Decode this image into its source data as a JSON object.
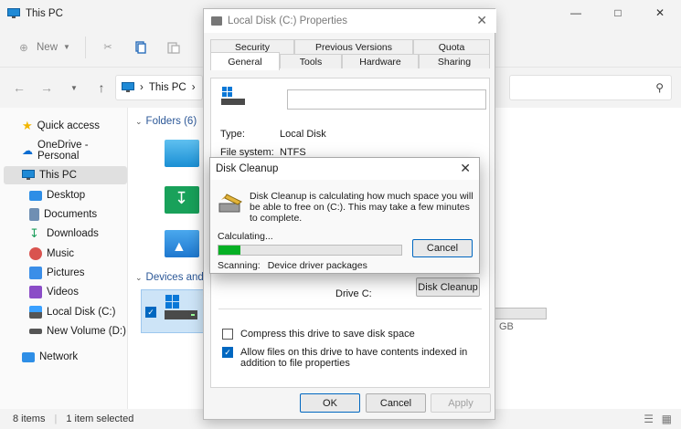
{
  "explorer": {
    "title": "This PC",
    "cmd": {
      "new_label": "New"
    },
    "address": {
      "location": "This PC"
    },
    "sidebar": [
      {
        "label": "Quick access",
        "icon": "star-icon"
      },
      {
        "label": "OneDrive - Personal",
        "icon": "cloud-icon"
      },
      {
        "label": "This PC",
        "icon": "pc-icon",
        "selected": true
      },
      {
        "label": "Desktop",
        "icon": "desktop-icon"
      },
      {
        "label": "Documents",
        "icon": "documents-icon"
      },
      {
        "label": "Downloads",
        "icon": "downloads-icon"
      },
      {
        "label": "Music",
        "icon": "music-icon"
      },
      {
        "label": "Pictures",
        "icon": "pictures-icon"
      },
      {
        "label": "Videos",
        "icon": "videos-icon"
      },
      {
        "label": "Local Disk (C:)",
        "icon": "drive-icon"
      },
      {
        "label": "New Volume (D:)",
        "icon": "drive-icon"
      },
      {
        "label": "Network",
        "icon": "network-icon"
      }
    ],
    "content": {
      "folders_header": "Folders (6)",
      "devices_header": "Devices and",
      "drive_size_partial": "GB"
    },
    "status": {
      "items": "8 items",
      "selected": "1 item selected"
    }
  },
  "props": {
    "title": "Local Disk (C:) Properties",
    "tabs_row1": [
      "Security",
      "Previous Versions",
      "Quota"
    ],
    "tabs_row2": [
      "General",
      "Tools",
      "Hardware",
      "Sharing"
    ],
    "type_label": "Type:",
    "type_value": "Local Disk",
    "fs_label": "File system:",
    "fs_value": "NTFS",
    "drive_label": "Drive C:",
    "disk_cleanup_button": "Disk Cleanup",
    "compress_label": "Compress this drive to save disk space",
    "compress_checked": false,
    "index_label": "Allow files on this drive to have contents indexed in addition to file properties",
    "index_checked": true,
    "ok": "OK",
    "cancel": "Cancel",
    "apply": "Apply"
  },
  "cleanup": {
    "title": "Disk Cleanup",
    "message": "Disk Cleanup is calculating how much space you will be able to free on  (C:). This may take a few minutes to complete.",
    "calculating": "Calculating...",
    "progress": 0.12,
    "progress_color": "#06b025",
    "cancel": "Cancel",
    "scanning_label": "Scanning:",
    "scanning_value": "Device driver packages"
  }
}
